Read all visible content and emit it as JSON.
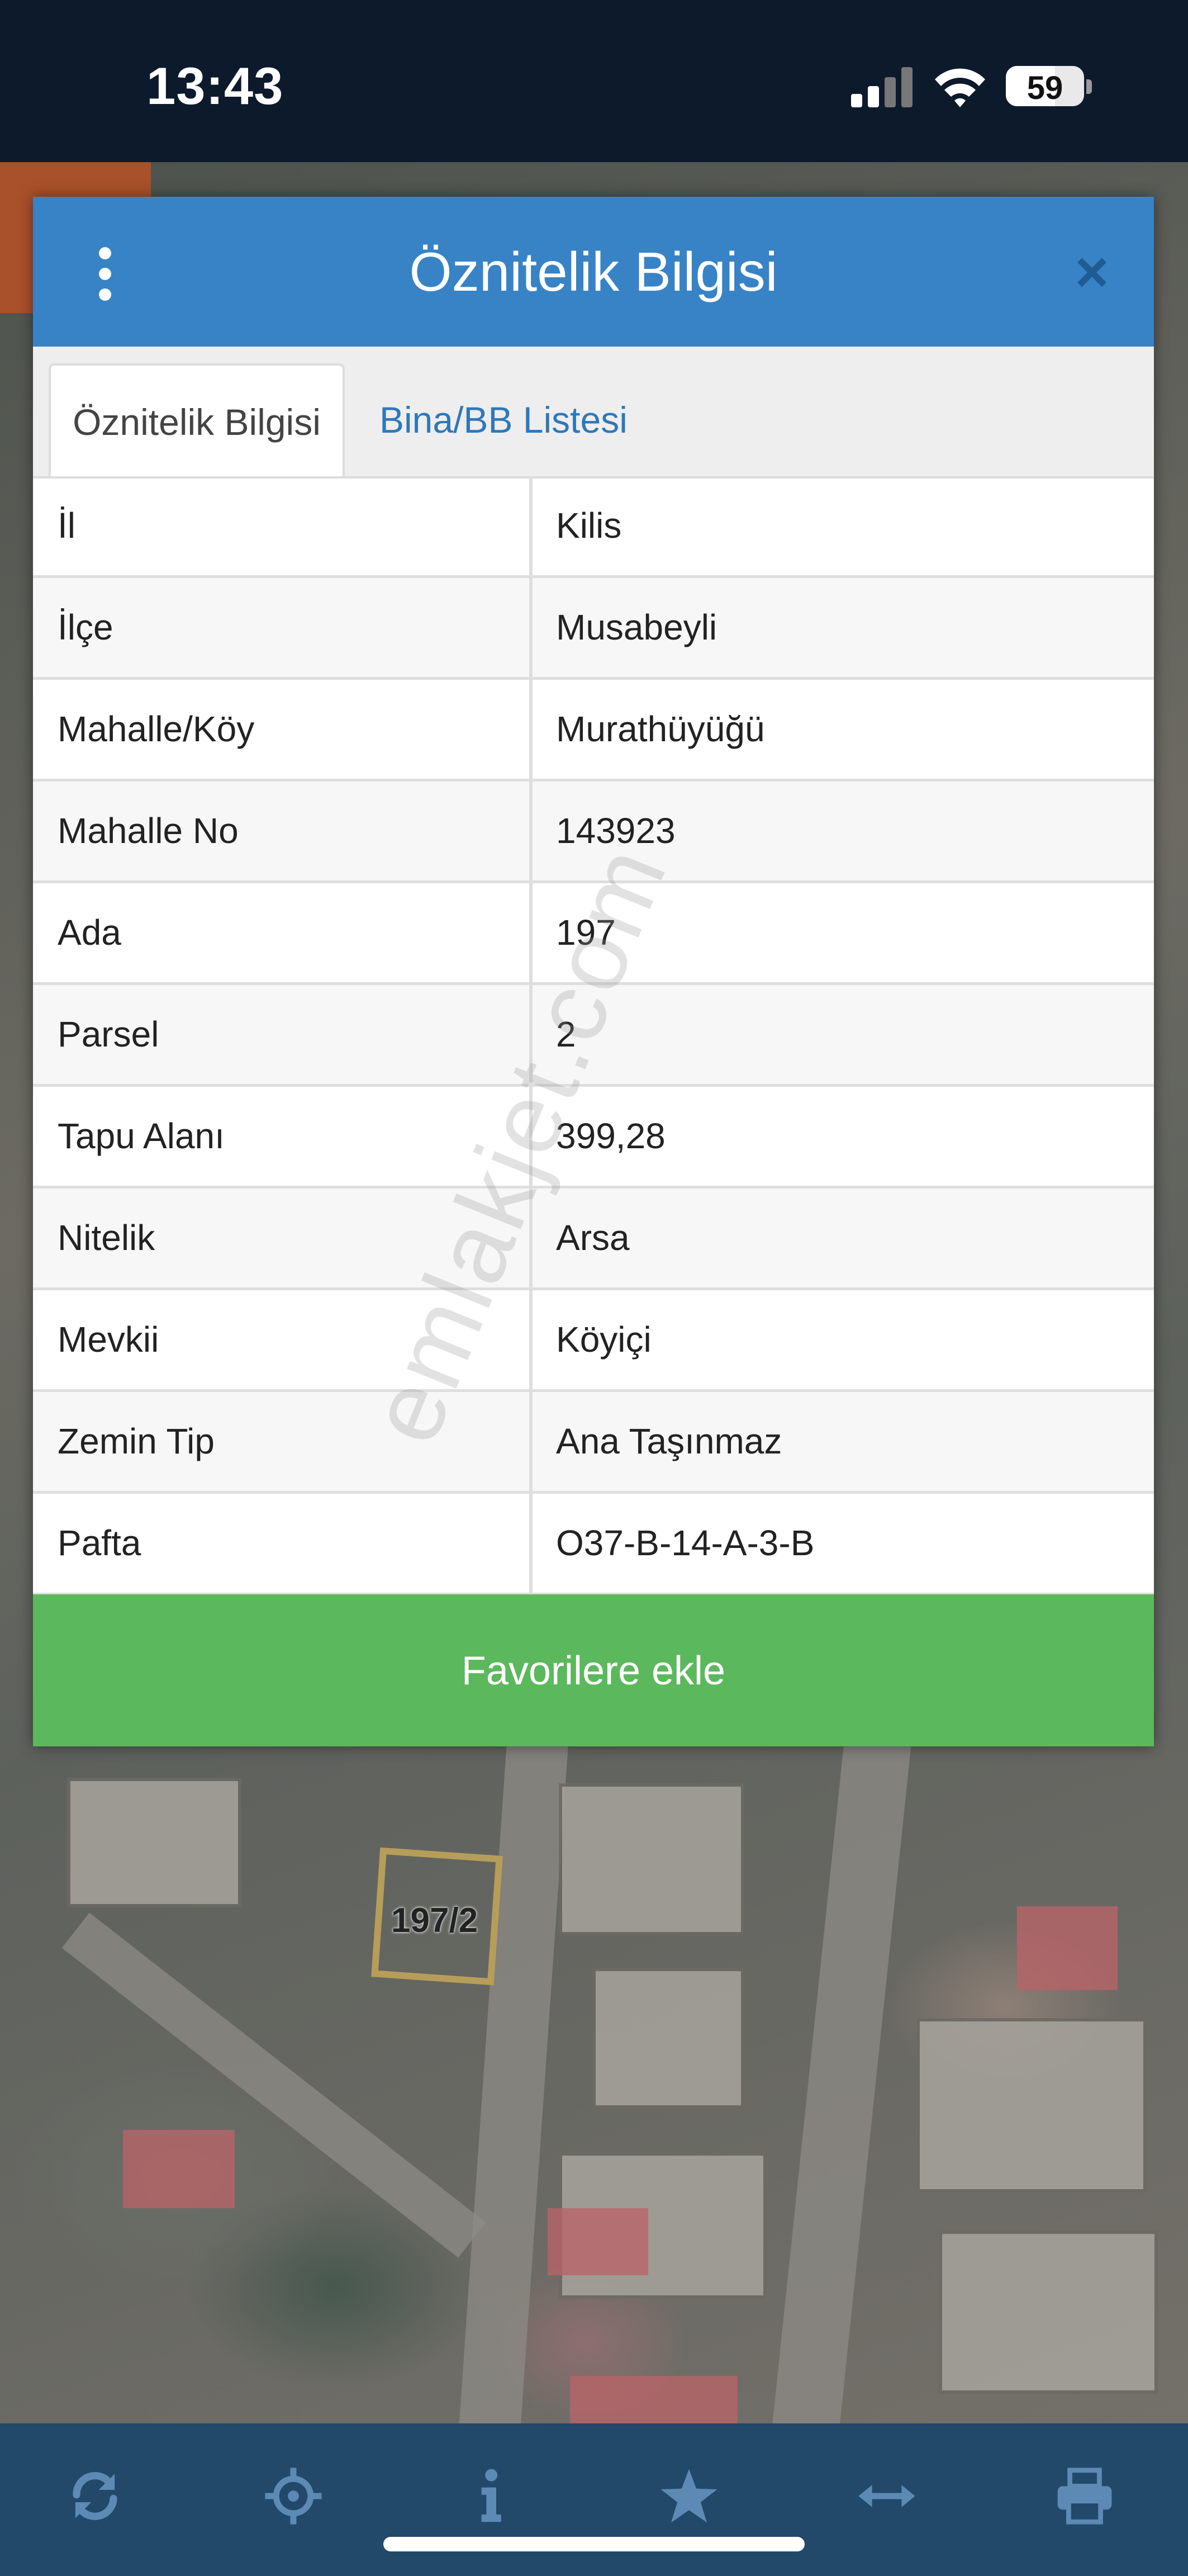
{
  "status_bar": {
    "time": "13:43",
    "battery": "59",
    "icons": [
      "cellular-signal-icon",
      "wifi-icon",
      "battery-icon"
    ]
  },
  "map": {
    "parcel_label": "197/2"
  },
  "modal": {
    "title": "Öznitelik Bilgisi",
    "menu_icon": "vertical-dots-icon",
    "close_icon": "close-icon",
    "tabs": [
      {
        "label": "Öznitelik Bilgisi",
        "active": true
      },
      {
        "label": "Bina/BB Listesi",
        "active": false
      }
    ],
    "rows": [
      {
        "label": "İl",
        "value": "Kilis"
      },
      {
        "label": "İlçe",
        "value": "Musabeyli"
      },
      {
        "label": "Mahalle/Köy",
        "value": "Murathüyüğü"
      },
      {
        "label": "Mahalle No",
        "value": "143923"
      },
      {
        "label": "Ada",
        "value": "197"
      },
      {
        "label": "Parsel",
        "value": "2"
      },
      {
        "label": "Tapu Alanı",
        "value": "399,28"
      },
      {
        "label": "Nitelik",
        "value": "Arsa"
      },
      {
        "label": "Mevkii",
        "value": "Köyiçi"
      },
      {
        "label": "Zemin Tip",
        "value": "Ana Taşınmaz"
      },
      {
        "label": "Pafta",
        "value": "O37-B-14-A-3-B"
      }
    ],
    "favorite_button": "Favorilere ekle",
    "watermark": "emlakjet.com"
  },
  "toolbar": {
    "icons": [
      "refresh-icon",
      "locate-icon",
      "info-icon",
      "star-icon",
      "measure-icon",
      "print-icon"
    ]
  },
  "colors": {
    "header_blue": "#3783c6",
    "tab_link_blue": "#2f78b8",
    "button_green": "#5cb85c",
    "toolbar_navy": "#22486a"
  }
}
